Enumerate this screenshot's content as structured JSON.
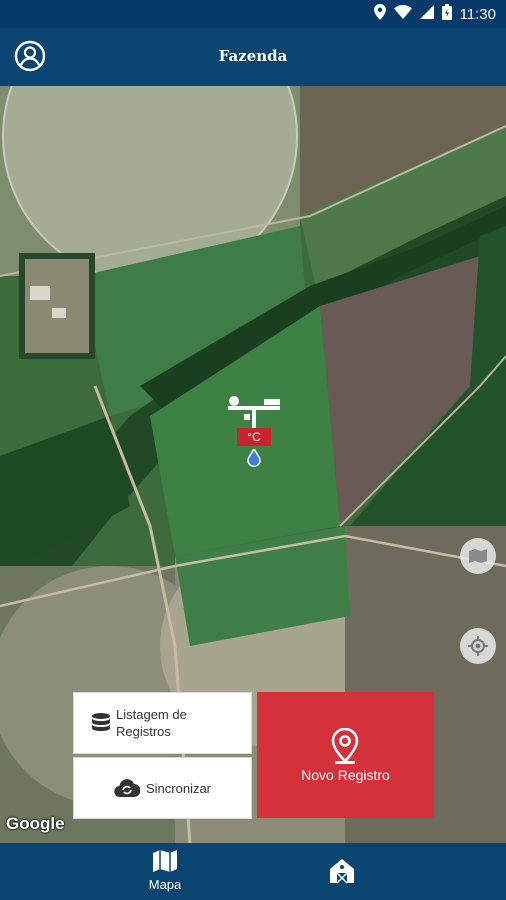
{
  "status_bar": {
    "time": "11:30",
    "icons": [
      "location-icon",
      "wifi-icon",
      "signal-icon",
      "battery-icon"
    ]
  },
  "app_bar": {
    "title": "Fazenda",
    "profile_icon": "account-circle-icon"
  },
  "map": {
    "marker": {
      "label": "°C",
      "icon": "weather-station-icon"
    },
    "attribution": "Google",
    "controls": [
      "layers-icon",
      "my-location-icon"
    ]
  },
  "actions": {
    "list_label": "Listagem de Registros",
    "sync_label": "Sincronizar",
    "new_label": "Novo Registro"
  },
  "bottom_nav": {
    "items": [
      {
        "label": "Mapa",
        "icon": "map-icon"
      },
      {
        "label": "",
        "icon": "farm-icon"
      }
    ]
  },
  "colors": {
    "primary": "#0a4471",
    "accent": "#d4313b"
  }
}
